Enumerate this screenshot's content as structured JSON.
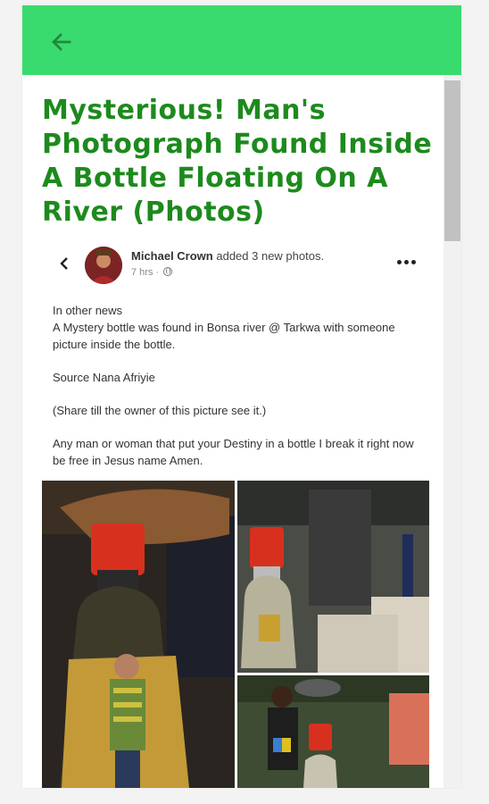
{
  "appbar": {
    "back_icon": "arrow-left-icon",
    "color": "#3adb6e"
  },
  "article": {
    "title": "Mysterious! Man's Photograph Found Inside A Bottle Floating On A River (Photos)",
    "title_color": "#1d8a1d"
  },
  "post": {
    "author": "Michael Crown",
    "action": " added 3 new photos.",
    "time": "7 hrs · ",
    "paragraphs": [
      "In other news\nA Mystery bottle was found in Bonsa river @ Tarkwa with someone picture inside the bottle.",
      "Source Nana Afriyie",
      "(Share till the owner of this picture see it.)",
      "Any man or woman that put your Destiny in a bottle I break it right now be free in Jesus name Amen."
    ],
    "photo_count": 3
  }
}
